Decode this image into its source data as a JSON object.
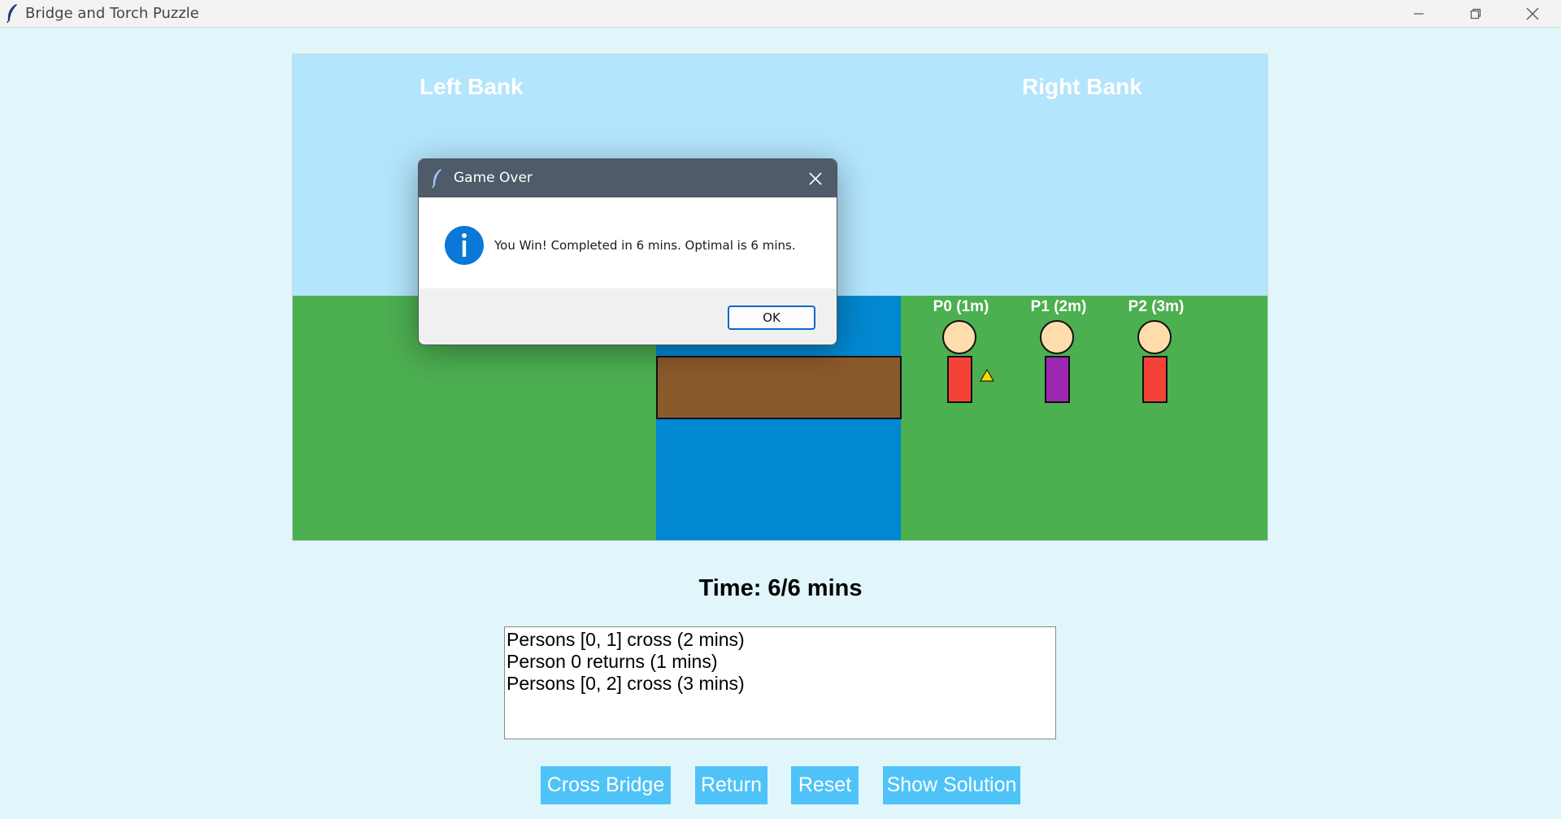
{
  "window": {
    "title": "Bridge and Torch Puzzle",
    "icon": "feather-icon",
    "controls": [
      "minimize-icon",
      "restore-icon",
      "close-icon"
    ]
  },
  "scene": {
    "left_bank_label": "Left Bank",
    "right_bank_label": "Right Bank",
    "people": [
      {
        "label": "P0 (1m)",
        "color": "#f44336",
        "bank": "right",
        "has_torch": true
      },
      {
        "label": "P1 (2m)",
        "color": "#9c27b0",
        "bank": "right",
        "has_torch": false
      },
      {
        "label": "P2 (3m)",
        "color": "#f44336",
        "bank": "right",
        "has_torch": false
      }
    ],
    "colors": {
      "sky": "#b3e5fc",
      "grass": "#4caf50",
      "river": "#0288d1",
      "bridge": "#8b5a2b",
      "torch": "#ffd600"
    }
  },
  "dialog": {
    "title": "Game Over",
    "icon": "info-icon",
    "message": "You Win! Completed in 6 mins. Optimal is 6 mins.",
    "ok_label": "OK"
  },
  "status": {
    "time_text": "Time: 6/6 mins"
  },
  "log": {
    "lines": [
      "Persons [0, 1] cross (2 mins)",
      "Person 0 returns (1 mins)",
      "Persons [0, 2] cross (3 mins)"
    ]
  },
  "controls": {
    "cross_label": "Cross Bridge",
    "return_label": "Return",
    "reset_label": "Reset",
    "solution_label": "Show Solution"
  }
}
